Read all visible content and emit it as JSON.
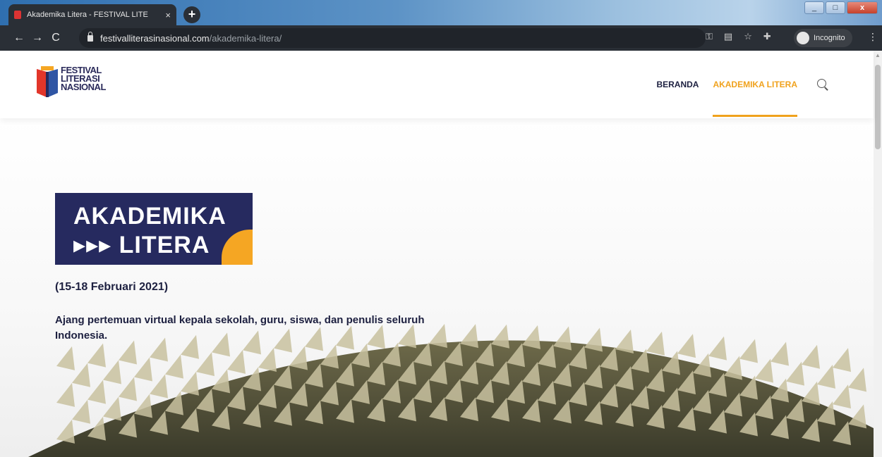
{
  "browser": {
    "tab_title": "Akademika Litera - FESTIVAL LITE",
    "tab_close": "×",
    "new_tab": "+",
    "url_host": "festivalliterasinasional.com",
    "url_path": "/akademika-litera/",
    "incognito_label": "Incognito",
    "back": "←",
    "forward": "→",
    "reload": "C",
    "window_buttons": {
      "minimize": "_",
      "maximize": "□",
      "close": "x"
    }
  },
  "header": {
    "logo_lines": [
      "FESTIVAL",
      "LITERASI",
      "NASIONAL"
    ],
    "nav": [
      {
        "label": "BERANDA",
        "active": false
      },
      {
        "label": "AKADEMIKA LITERA",
        "active": true
      }
    ]
  },
  "hero": {
    "badge_line1": "AKADEMIKA",
    "badge_line2": "▸▸▸ LITERA",
    "date": "(15-18 Februari 2021)",
    "description": "Ajang pertemuan virtual kepala sekolah, guru, siswa, dan penulis seluruh Indonesia."
  },
  "colors": {
    "brand_navy": "#262a5f",
    "accent_orange": "#f0a21d",
    "chrome_dark": "#2a2f36"
  }
}
